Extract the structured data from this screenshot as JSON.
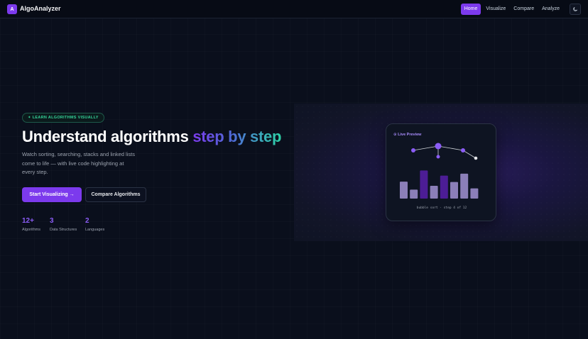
{
  "nav": {
    "logo_letter": "A",
    "brand": "AlgoAnalyzer",
    "links": [
      "Home",
      "Visualize",
      "Compare",
      "Analyze"
    ],
    "active_link": "Home",
    "theme_icon": "moon-icon"
  },
  "hero": {
    "badge": "✦ LEARN ALGORITHMS VISUALLY",
    "headline_plain": "Understand algorithms ",
    "headline_accent": "step by step",
    "subtitle": "Watch sorting, searching, stacks and linked lists come to life — with live code highlighting at every step.",
    "primary_cta": "Start Visualizing →",
    "secondary_cta": "Compare Algorithms",
    "stats": [
      {
        "value": "12+",
        "label": "Algorithms"
      },
      {
        "value": "3",
        "label": "Data Structures"
      },
      {
        "value": "2",
        "label": "Languages"
      }
    ]
  },
  "preview": {
    "title": "⊙ Live Preview",
    "footer": "bubble sort · step 4 of 12",
    "bars": [
      {
        "value": 0.53,
        "color": "#8b7fb8"
      },
      {
        "value": 0.28,
        "color": "#8b7fb8"
      },
      {
        "value": 0.88,
        "color": "#4c1d95"
      },
      {
        "value": 0.4,
        "color": "#8b7fb8"
      },
      {
        "value": 0.72,
        "color": "#4c1d95"
      },
      {
        "value": 0.52,
        "color": "#8b7fb8"
      },
      {
        "value": 0.78,
        "color": "#8b7fb8"
      },
      {
        "value": 0.32,
        "color": "#8b7fb8"
      }
    ],
    "colors": {
      "accent": "#7c3aed",
      "node": "#8b5cf6"
    }
  }
}
